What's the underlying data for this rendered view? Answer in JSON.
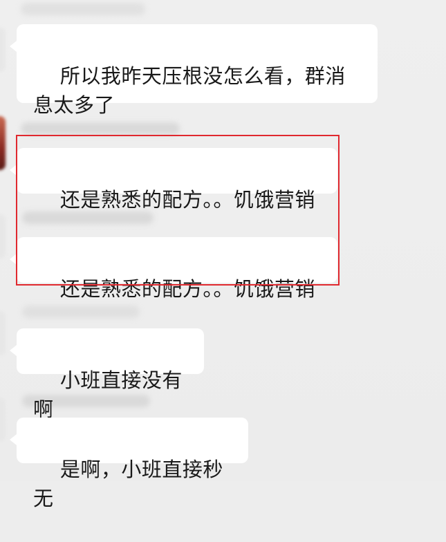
{
  "messages": [
    {
      "text": "所以我昨天压根没怎么看，群消息太多了"
    },
    {
      "text": "还是熟悉的配方。。饥饿营销"
    },
    {
      "text": "还是熟悉的配方。。饥饿营销"
    },
    {
      "text": "小班直接没有啊"
    },
    {
      "text": "是啊，小班直接秒无"
    }
  ],
  "annotation": {
    "color": "#e0282e"
  }
}
